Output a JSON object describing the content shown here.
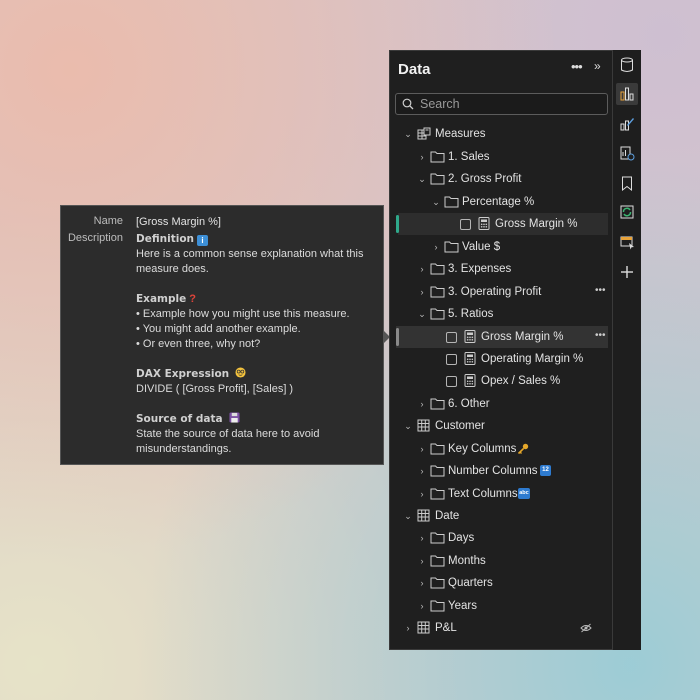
{
  "pane": {
    "title": "Data",
    "more_icon": "more-options-icon",
    "expand_icon": "expand-pane-icon",
    "search_placeholder": "Search"
  },
  "tree": {
    "measures": "Measures",
    "sales": "1. Sales",
    "gross_profit": "2. Gross Profit",
    "percentage": "Percentage %",
    "gross_margin_pct_1": "Gross Margin %",
    "value": "Value $",
    "expenses": "3. Expenses",
    "operating_profit": "3. Operating Profit",
    "ratios": "5. Ratios",
    "gross_margin_pct_2": "Gross Margin %",
    "operating_margin": "Operating Margin %",
    "opex_sales": "Opex / Sales %",
    "other": "6. Other",
    "customer": "Customer",
    "key_columns": "Key Columns",
    "number_columns": "Number Columns",
    "text_columns": "Text Columns",
    "date": "Date",
    "days": "Days",
    "months": "Months",
    "quarters": "Quarters",
    "years": "Years",
    "pl": "P&L"
  },
  "tooltip": {
    "name_key": "Name",
    "name_value": "[Gross Margin %]",
    "description_key": "Description",
    "definition_heading": "Definition",
    "definition_text_1": "Here is a common sense explanation what this",
    "definition_text_2": "measure does.",
    "example_heading": "Example",
    "example_1": "• Example how you might use this measure.",
    "example_2": "• You might add another example.",
    "example_3": "• Or even three, why not?",
    "dax_heading": "DAX Expression",
    "dax_text": "DIVIDE ( [Gross Profit], [Sales] )",
    "source_heading": "Source of data",
    "source_text_1": "State the source of data here to avoid",
    "source_text_2": "misunderstandings."
  },
  "colors": {
    "pane_bg": "#1f1f1f",
    "accent_green": "#2fa98b",
    "tooltip_bg": "#2c2c2c",
    "info_blue": "#3d8fd6",
    "numbers_blue": "#2e7bd0"
  },
  "strip_icons": [
    "data-icon",
    "build-visual-icon",
    "format-visual-icon",
    "performance-icon",
    "bookmark-icon",
    "sync-icon",
    "selection-icon",
    "add-icon"
  ]
}
